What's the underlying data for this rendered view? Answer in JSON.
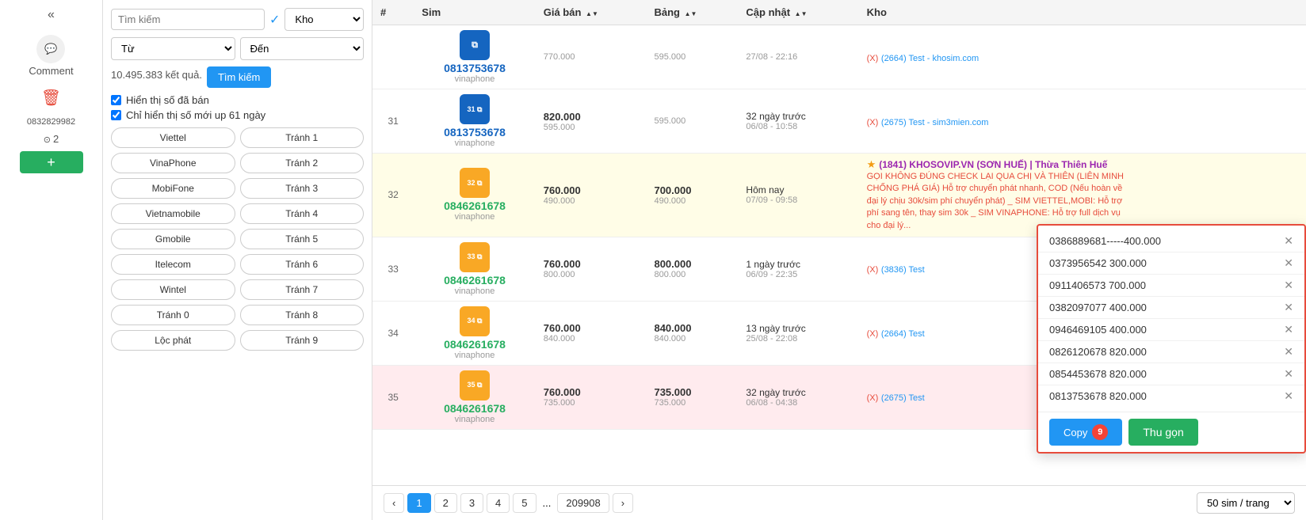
{
  "sidebar": {
    "collapse_icon": "«",
    "comment_label": "Comment",
    "delete_icon": "🗑",
    "phone1": "0832829982",
    "phone2": "2",
    "add_label": "+"
  },
  "filter": {
    "search_placeholder": "Tìm kiếm",
    "search_icon": "✓",
    "kho_placeholder": "Kho",
    "from_placeholder": "Từ",
    "to_placeholder": "Đến",
    "search_btn": "Tìm kiếm",
    "results_count": "10.495.383 kết quả.",
    "checkbox1": "Hiển thị số đã bán",
    "checkbox2": "Chỉ hiển thị số mới up 61 ngày",
    "tags": [
      "Viettel",
      "Tránh 1",
      "VinaPhone",
      "Tránh 2",
      "MobiFone",
      "Tránh 3",
      "Vietnamobile",
      "Tránh 4",
      "Gmobile",
      "Tránh 5",
      "Itelecom",
      "Tránh 6",
      "Wintel",
      "Tránh 7",
      "Tránh 0",
      "Tránh 8",
      "Lộc phát",
      "Tránh 9"
    ]
  },
  "table": {
    "headers": [
      "#",
      "Sim",
      "Giá bán",
      "Bảng",
      "Cập nhật",
      "Kho"
    ],
    "rows": [
      {
        "num": "",
        "badge_color": "blue",
        "badge_num": "",
        "sim": "0813753678",
        "sim_color": "normal",
        "network": "vinaphone",
        "price_main": "",
        "price_sub": "770.000",
        "bang_main": "",
        "bang_sub": "595.000",
        "update_main": "",
        "update_sub": "27/08 - 22:16",
        "kho_type": "x_link",
        "kho_prefix": "(X)",
        "kho_text": "(2664) Test - khosim.com"
      },
      {
        "num": "31",
        "badge_color": "blue",
        "badge_num": "31",
        "sim": "0813753678",
        "sim_color": "normal",
        "network": "vinaphone",
        "price_main": "820.000",
        "price_sub": "595.000",
        "bang_main": "",
        "bang_sub": "595.000",
        "update_main": "32 ngày trước",
        "update_sub": "06/08 - 10:58",
        "kho_type": "x_link",
        "kho_prefix": "(X)",
        "kho_text": "(2675) Test - sim3mien.com"
      },
      {
        "num": "32",
        "badge_color": "yellow",
        "badge_num": "32",
        "sim": "0846261678",
        "sim_color": "green",
        "network": "vinaphone",
        "price_main": "760.000",
        "price_sub": "490.000",
        "bang_main": "700.000",
        "bang_sub": "490.000",
        "update_main": "Hôm nay",
        "update_sub": "07/09 - 09:58",
        "kho_type": "star_link",
        "kho_star": "★",
        "kho_text": "(1841) KHOSOVIP.VN (SƠN HUẾ) | Thừa Thiên Huế",
        "kho_note": "GỌI KHÔNG ĐÚNG CHECK LẠI QUA CHỊ VÀ THIÊN (LIÊN MINH CHỐNG PHÁ GIÁ) Hỗ trợ chuyển phát nhanh, COD (Nếu hoàn về đại lý chịu 30k/sim phí chuyển phát) _ SIM VIETTEL,MOBI: Hỗ trợ phí sang tên, thay sim 30k _ SIM VINAPHONE: Hỗ trợ full dịch vụ cho đại lý..."
      },
      {
        "num": "33",
        "badge_color": "yellow",
        "badge_num": "33",
        "sim": "0846261678",
        "sim_color": "green",
        "network": "vinaphone",
        "price_main": "760.000",
        "price_sub": "800.000",
        "bang_main": "800.000",
        "bang_sub": "800.000",
        "update_main": "1 ngày trước",
        "update_sub": "06/09 - 22:35",
        "kho_type": "x_link",
        "kho_prefix": "(X)",
        "kho_text": "(3836) Test"
      },
      {
        "num": "34",
        "badge_color": "yellow",
        "badge_num": "34",
        "sim": "0846261678",
        "sim_color": "green",
        "network": "vinaphone",
        "price_main": "760.000",
        "price_sub": "840.000",
        "bang_main": "840.000",
        "bang_sub": "840.000",
        "update_main": "13 ngày trước",
        "update_sub": "25/08 - 22:08",
        "kho_type": "x_link",
        "kho_prefix": "(X)",
        "kho_text": "(2664) Test"
      },
      {
        "num": "35",
        "badge_color": "yellow",
        "badge_num": "35",
        "sim": "0846261678",
        "sim_color": "green",
        "network": "vinaphone",
        "price_main": "760.000",
        "price_sub": "735.000",
        "bang_main": "735.000",
        "bang_sub": "735.000",
        "update_main": "32 ngày trước",
        "update_sub": "06/08 - 04:38",
        "kho_type": "x_link",
        "kho_prefix": "(X)",
        "kho_text": "(2675) Test"
      }
    ]
  },
  "pagination": {
    "prev": "‹",
    "next": "›",
    "pages": [
      "1",
      "2",
      "3",
      "4",
      "5",
      "...",
      "209908"
    ],
    "active_page": "1",
    "page_size": "50 sim / trang"
  },
  "popup": {
    "items": [
      "0386889681-----400.000",
      "0373956542 300.000",
      "0911406573 700.000",
      "0382097077 400.000",
      "0946469105 400.000",
      "0826120678 820.000",
      "0854453678 820.000",
      "0813753678 820.000"
    ],
    "copy_label": "Copy",
    "copy_count": "9",
    "collapse_label": "Thu gọn"
  }
}
